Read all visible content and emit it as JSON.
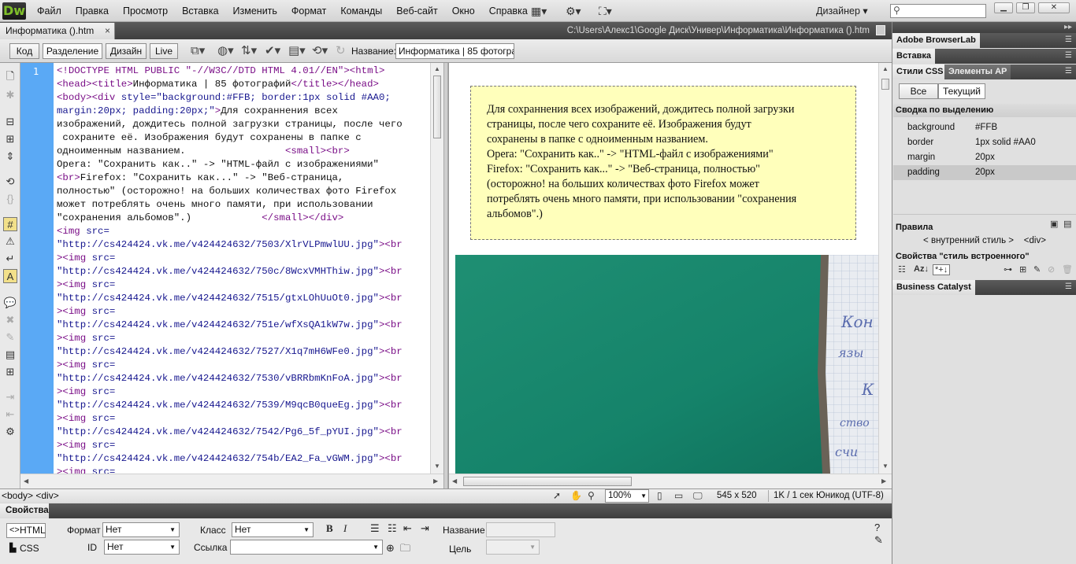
{
  "app": {
    "logo": "Dw",
    "menus": [
      "Файл",
      "Правка",
      "Просмотр",
      "Вставка",
      "Изменить",
      "Формат",
      "Команды",
      "Веб-сайт",
      "Окно",
      "Справка"
    ],
    "workspace": "Дизайнер",
    "window_buttons": [
      "minimize-icon",
      "restore-icon",
      "close-icon"
    ]
  },
  "document": {
    "tab_label": "Информатика  ().htm",
    "path": "C:\\Users\\Алекс1\\Google Диск\\Универ\\Информатика\\Информатика  ().htm"
  },
  "toolbar": {
    "views": [
      "Код",
      "Разделение",
      "Дизайн",
      "Live"
    ],
    "active_view": "Разделение",
    "title_label": "Название:",
    "title_value": "Информатика | 85 фотограф"
  },
  "code": {
    "line_number": "1",
    "lines": [
      [
        [
          "tag",
          "<!DOCTYPE HTML PUBLIC \"-//W3C//DTD HTML 4.01//EN\"><html>"
        ]
      ],
      [
        [
          "tag",
          "<head><title>"
        ],
        [
          "txt",
          "Информатика | 85 фотографий"
        ],
        [
          "tag",
          "</title></head>"
        ]
      ],
      [
        [
          "tag",
          "<body><div "
        ],
        [
          "att",
          "style=\"background:#FFB; border:1px solid #AA0;"
        ]
      ],
      [
        [
          "att",
          "margin:20px; padding:20px;\""
        ],
        [
          "tag",
          ">"
        ],
        [
          "txt",
          "Для сохраннения всех"
        ]
      ],
      [
        [
          "txt",
          "изображений, дождитесь полной загрузки страницы, после чего"
        ]
      ],
      [
        [
          "txt",
          " сохраните её. Изображения будут сохранены в папке с"
        ]
      ],
      [
        [
          "txt",
          "одноименным названием.                 "
        ],
        [
          "tag",
          "<small><br>"
        ]
      ],
      [
        [
          "txt",
          "Opera: \"Сохранить как..\" -> \"HTML-файл с изображениями\""
        ]
      ],
      [
        [
          "tag",
          "<br>"
        ],
        [
          "txt",
          "Firefox: \"Сохранить как...\" -> \"Веб-страница,"
        ]
      ],
      [
        [
          "txt",
          "полностью\" (осторожно! на больших количествах фото Firefox"
        ]
      ],
      [
        [
          "txt",
          "может потреблять очень много памяти, при использовании"
        ]
      ],
      [
        [
          "txt",
          "\"сохранения альбомов\".)            "
        ],
        [
          "tag",
          "</small></div>"
        ]
      ],
      [
        [
          "tag",
          "<img "
        ],
        [
          "att",
          "src="
        ]
      ],
      [
        [
          "att",
          "\"http://cs424424.vk.me/v424424632/7503/XlrVLPmwlUU.jpg\""
        ],
        [
          "tag",
          "><br"
        ]
      ],
      [
        [
          "tag",
          "><img "
        ],
        [
          "att",
          "src="
        ]
      ],
      [
        [
          "att",
          "\"http://cs424424.vk.me/v424424632/750c/8WcxVMHThiw.jpg\""
        ],
        [
          "tag",
          "><br"
        ]
      ],
      [
        [
          "tag",
          "><img "
        ],
        [
          "att",
          "src="
        ]
      ],
      [
        [
          "att",
          "\"http://cs424424.vk.me/v424424632/7515/gtxLOhUuOt0.jpg\""
        ],
        [
          "tag",
          "><br"
        ]
      ],
      [
        [
          "tag",
          "><img "
        ],
        [
          "att",
          "src="
        ]
      ],
      [
        [
          "att",
          "\"http://cs424424.vk.me/v424424632/751e/wfXsQA1kW7w.jpg\""
        ],
        [
          "tag",
          "><br"
        ]
      ],
      [
        [
          "tag",
          "><img "
        ],
        [
          "att",
          "src="
        ]
      ],
      [
        [
          "att",
          "\"http://cs424424.vk.me/v424424632/7527/X1q7mH6WFe0.jpg\""
        ],
        [
          "tag",
          "><br"
        ]
      ],
      [
        [
          "tag",
          "><img "
        ],
        [
          "att",
          "src="
        ]
      ],
      [
        [
          "att",
          "\"http://cs424424.vk.me/v424424632/7530/vBRRbmKnFoA.jpg\""
        ],
        [
          "tag",
          "><br"
        ]
      ],
      [
        [
          "tag",
          "><img "
        ],
        [
          "att",
          "src="
        ]
      ],
      [
        [
          "att",
          "\"http://cs424424.vk.me/v424424632/7539/M9qcB0queEg.jpg\""
        ],
        [
          "tag",
          "><br"
        ]
      ],
      [
        [
          "tag",
          "><img "
        ],
        [
          "att",
          "src="
        ]
      ],
      [
        [
          "att",
          "\"http://cs424424.vk.me/v424424632/7542/Pg6_5f_pYUI.jpg\""
        ],
        [
          "tag",
          "><br"
        ]
      ],
      [
        [
          "tag",
          "><img "
        ],
        [
          "att",
          "src="
        ]
      ],
      [
        [
          "att",
          "\"http://cs424424.vk.me/v424424632/754b/EA2_Fa_vGWM.jpg\""
        ],
        [
          "tag",
          "><br"
        ]
      ],
      [
        [
          "tag",
          "><img "
        ],
        [
          "att",
          "src="
        ]
      ]
    ]
  },
  "preview": {
    "lines": [
      "Для сохраннения всех изображений, дождитесь полной загрузки",
      "страницы, после чего сохраните её. Изображения будут",
      "сохранены в папке с одноименным названием.",
      "Opera: \"Сохранить как..\" -> \"HTML-файл с изображениями\"",
      "Firefox: \"Сохранить как...\" -> \"Веб-страница, полностью\"",
      "(осторожно! на больших количествах фото Firefox может",
      "потреблять очень много памяти, при использовании \"сохранения",
      "альбомов\".)"
    ]
  },
  "status": {
    "tag_selector": "<body> <div>",
    "zoom": "100%",
    "dimensions": "545 x 520",
    "download": "1K / 1 сек",
    "encoding": "Юникод (UTF-8)"
  },
  "properties": {
    "tab": "Свойства",
    "html_btn": "HTML",
    "css_btn": "CSS",
    "format_label": "Формат",
    "format_value": "Нет",
    "class_label": "Класс",
    "class_value": "Нет",
    "id_label": "ID",
    "id_value": "Нет",
    "link_label": "Ссылка",
    "link_value": "",
    "name_label": "Название",
    "target_label": "Цель",
    "bold": "B",
    "italic": "I"
  },
  "panels": {
    "browserlab": "Adobe BrowserLab",
    "insert": "Вставка",
    "css_tab": "Стили CSS",
    "ap_tab": "Элементы AP",
    "seg_all": "Все",
    "seg_current": "Текущий",
    "summary_title": "Сводка по выделению",
    "summary": [
      {
        "k": "background",
        "v": "#FFB"
      },
      {
        "k": "border",
        "v": "1px solid #AA0"
      },
      {
        "k": "margin",
        "v": "20px"
      },
      {
        "k": "padding",
        "v": "20px"
      }
    ],
    "rules_title": "Правила",
    "rules_row": "< внутренний стиль >    <div>",
    "props_of": "Свойства \"стиль встроенного\"",
    "business_catalyst": "Business Catalyst"
  }
}
